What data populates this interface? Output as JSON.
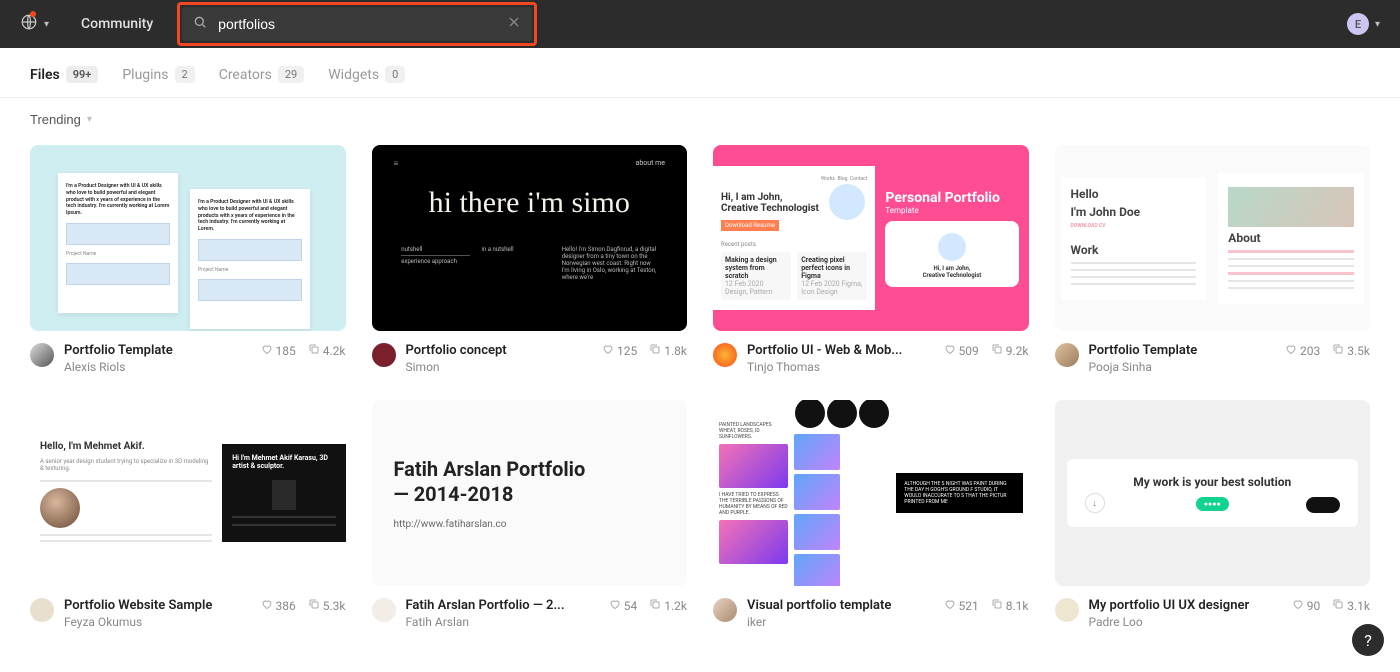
{
  "header": {
    "community_label": "Community",
    "search_value": "portfolios",
    "user_initial": "E"
  },
  "tabs": [
    {
      "label": "Files",
      "count": "99+",
      "active": true
    },
    {
      "label": "Plugins",
      "count": "2",
      "active": false
    },
    {
      "label": "Creators",
      "count": "29",
      "active": false
    },
    {
      "label": "Widgets",
      "count": "0",
      "active": false
    }
  ],
  "filter": {
    "sort_label": "Trending"
  },
  "cards": [
    {
      "title": "Portfolio Template",
      "author": "Alexis Riols",
      "likes": "185",
      "copies": "4.2k",
      "thumb": "t1",
      "av": "av-1"
    },
    {
      "title": "Portfolio concept",
      "author": "Simon",
      "likes": "125",
      "copies": "1.8k",
      "thumb": "t2",
      "av": "av-2"
    },
    {
      "title": "Portfolio UI - Web & Mob...",
      "author": "Tinjo Thomas",
      "likes": "509",
      "copies": "9.2k",
      "thumb": "t3",
      "av": "av-3"
    },
    {
      "title": "Portfolio Template",
      "author": "Pooja Sinha",
      "likes": "203",
      "copies": "3.5k",
      "thumb": "t4",
      "av": "av-4"
    },
    {
      "title": "Portfolio Website Sample",
      "author": "Feyza Okumus",
      "likes": "386",
      "copies": "5.3k",
      "thumb": "t5",
      "av": "av-5"
    },
    {
      "title": "Fatih Arslan Portfolio — 2...",
      "author": "Fatih Arslan",
      "likes": "54",
      "copies": "1.2k",
      "thumb": "t6",
      "av": "av-6"
    },
    {
      "title": "Visual portfolio template",
      "author": "iker",
      "likes": "521",
      "copies": "8.1k",
      "thumb": "t7",
      "av": "av-7"
    },
    {
      "title": "My portfolio UI UX designer",
      "author": "Padre Loo",
      "likes": "90",
      "copies": "3.1k",
      "thumb": "t8",
      "av": "av-8"
    }
  ],
  "thumb_text": {
    "t1_p1": "I'm a Product Designer with UI & UX skills who love to build powerful and elegant product with x years of experience in the tech industry. I'm currently working at Lorem Ipsum.",
    "t1_p2": "I'm a Product Designer with UI & UX skills who love to build powerful and elegant products with x years of experience in the tech industry. I'm currently working at Lorem.",
    "t1_proj": "Project Name",
    "t2_hero": "hi there i'm simo",
    "t2_nav": "about me",
    "t2_c1a": "nutshell",
    "t2_c1b": "experience approach",
    "t2_c2": "in a nutshell",
    "t2_c3": "Hello! I'm Simon Dagfinrud, a digital designer from a tiny town on the Norwegian west coast. Right now I'm living in Oslo, working at Teston, where we're",
    "t3_hi": "Hi, I am John,",
    "t3_sub": "Creative Technologist",
    "t3_title": "Personal Portfolio",
    "t3_tmpl": "Template",
    "t3_btn": "Download Resume",
    "t3_recent": "Recent posts",
    "t3_navw": "Works",
    "t3_navb": "Blog",
    "t3_navc": "Contact",
    "t3_p1a": "Making a design system from scratch",
    "t3_p1b": "12 Feb 2020   Design, Pattern",
    "t3_p2a": "Creating pixel perfect icons in Figma",
    "t3_p2b": "12 Feb 2020   Figma, Icon Design",
    "t4_hello": "Hello",
    "t4_im": "I'm John Doe",
    "t4_dl": "DOWNLOAD CV",
    "t4_work": "Work",
    "t4_about": "About",
    "t5_hello": "Hello, I'm Mehmet Akif.",
    "t5_lead": "A senior year design student trying to specialize in 3D modeling & texturing.",
    "t5_rp1": "Hi I'm Mehmet Akif Karasu, 3D artist & sculptor.",
    "t6_big1": "Fatih Arslan Portfolio",
    "t6_big2": "— 2014-2018",
    "t6_url": "http://www.fatiharslan.co",
    "t7_blk": "ALTHOUGH THE S NIGHT WAS PAINT DURING THE DAY H GOGH'S GROUND F STUDIO, IT WOULD INACCURATE TO S THAT THE PICTUR PRINTED FROM ME",
    "t7_c1a": "PAINTED LANDSCAPES WHEAT, ROSES, ID SUNFLOWERS.",
    "t7_c1b": "I HAVE TRIED TO EXPRESS THE TERRIBLE PASSIONS OF HUMANITY BY MEANS OF RED AND PURPLE.",
    "t8_slog": "My work is your best solution"
  },
  "help_label": "?"
}
